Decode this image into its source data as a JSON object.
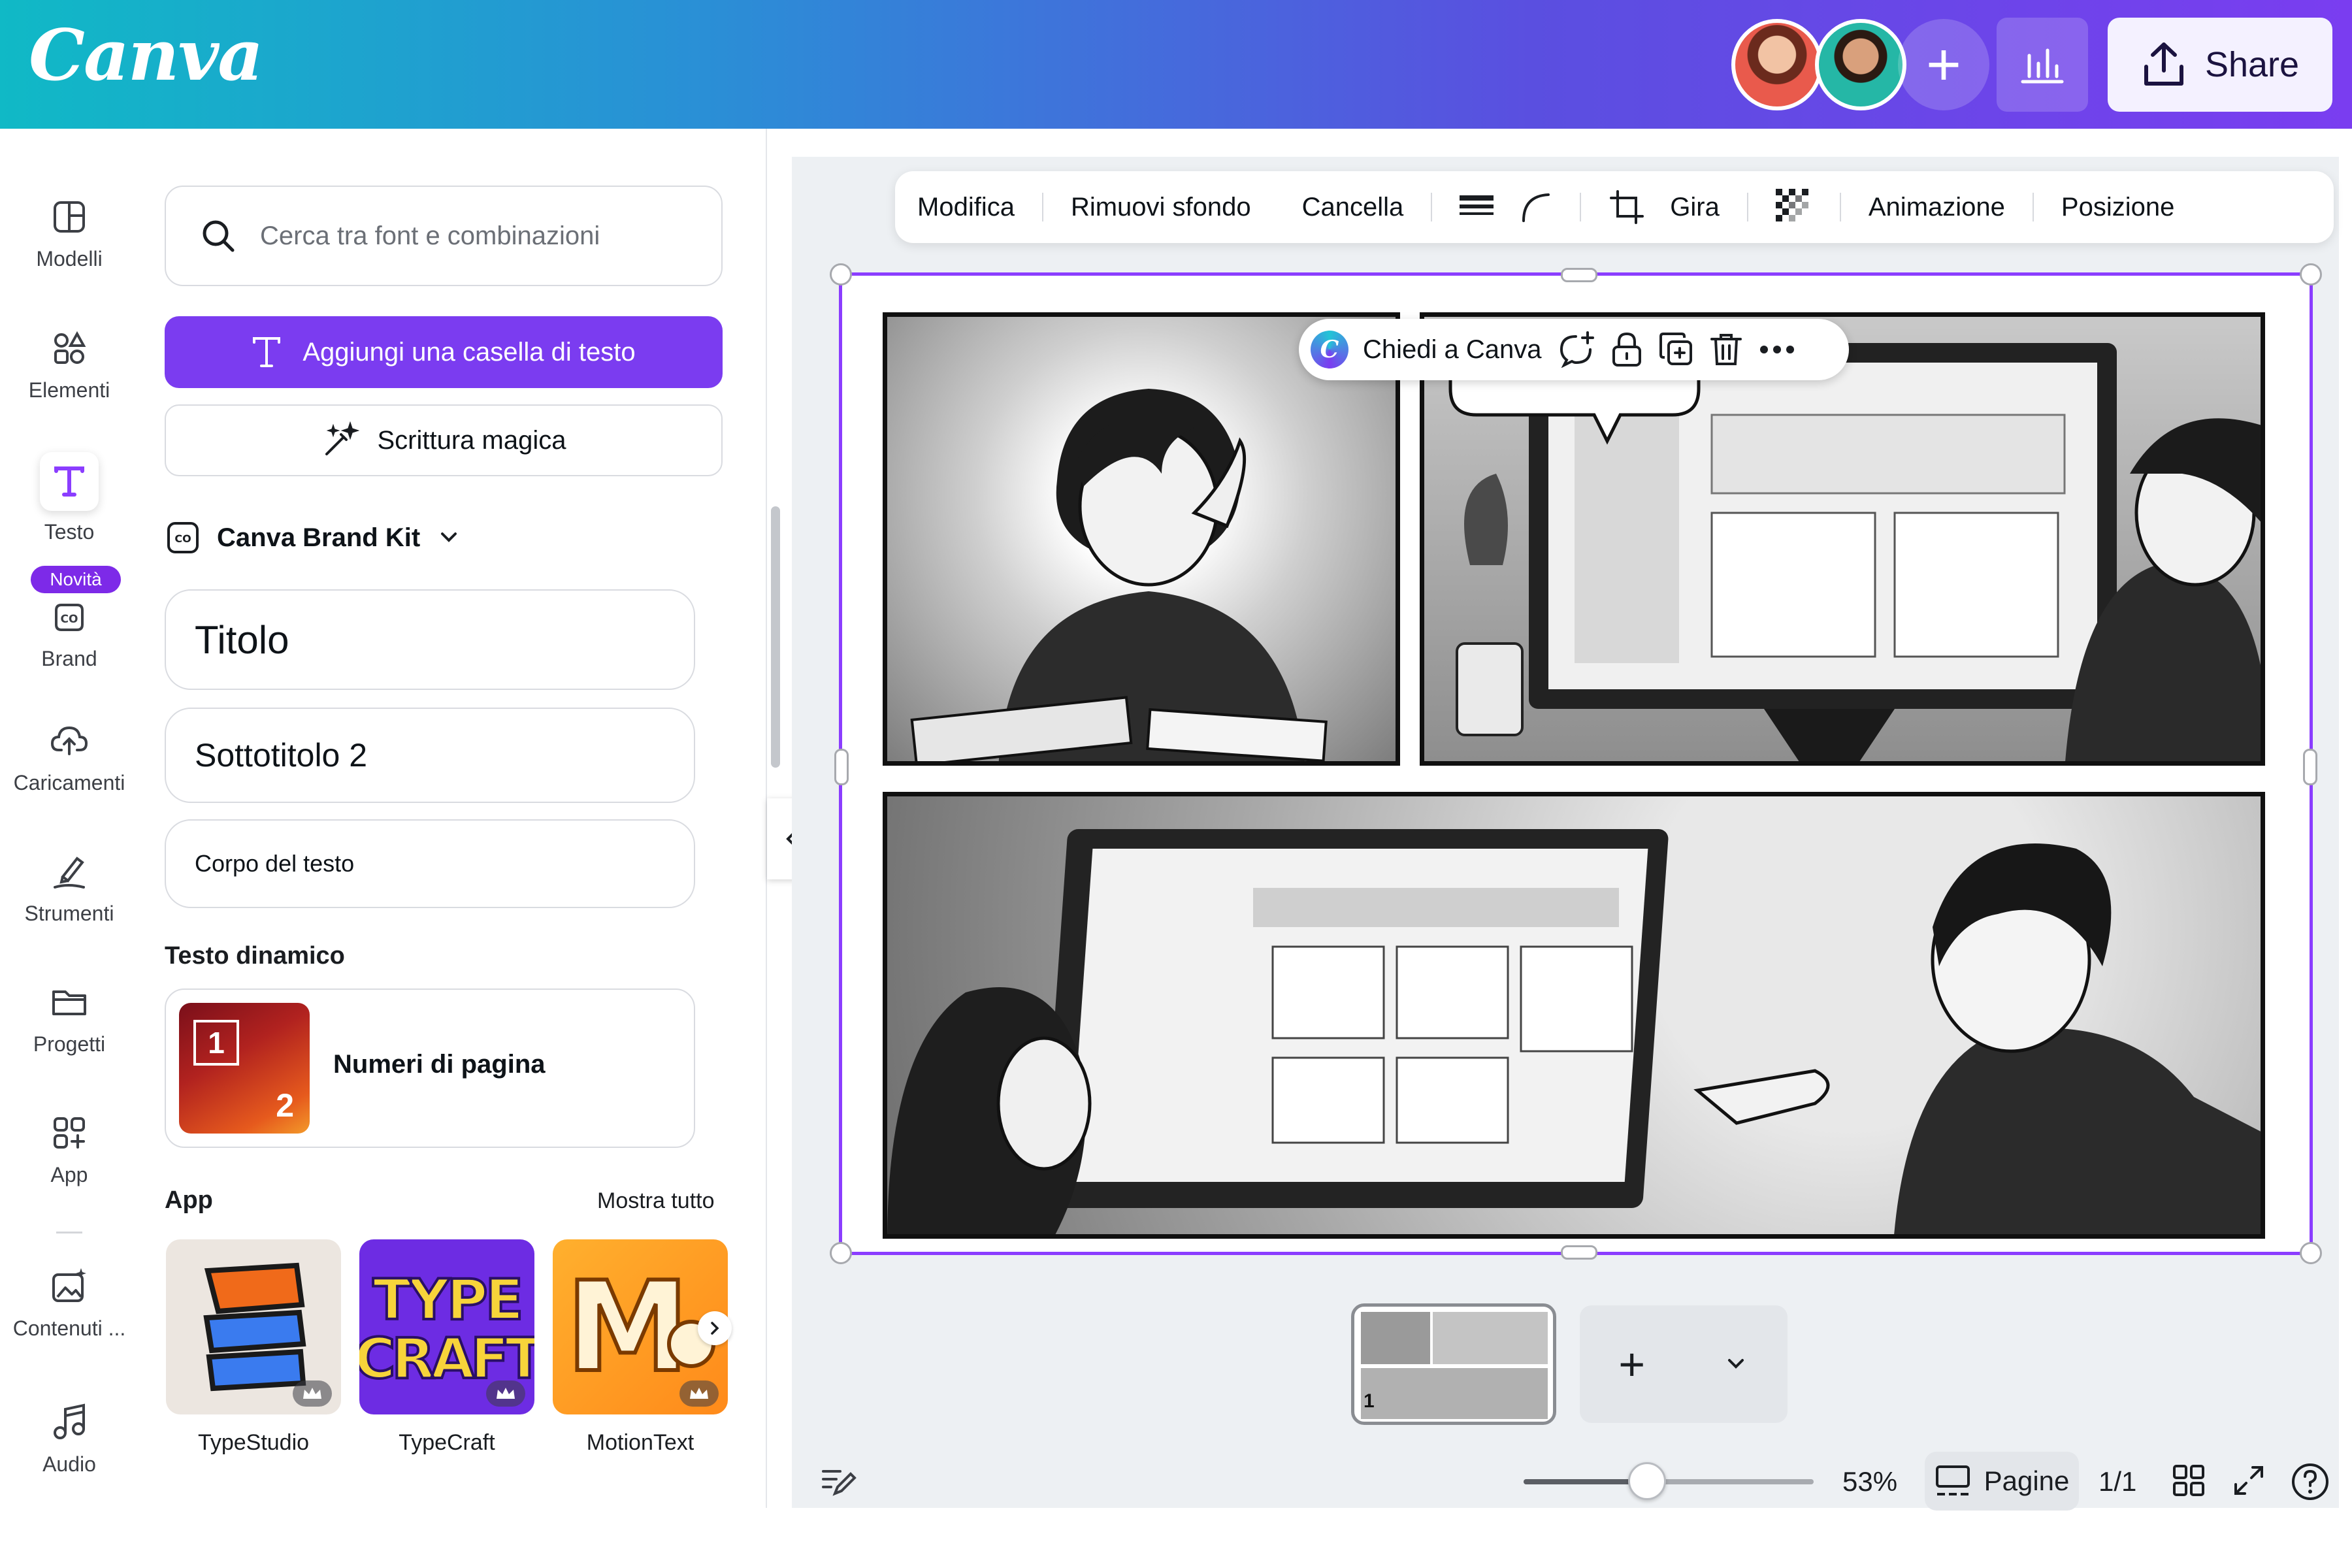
{
  "header": {
    "logo": "Canva",
    "share_label": "Share",
    "add_collaborator": "+"
  },
  "rail": {
    "items": [
      {
        "label": "Modelli",
        "icon": "template-icon"
      },
      {
        "label": "Elementi",
        "icon": "elements-icon"
      },
      {
        "label": "Testo",
        "icon": "text-icon"
      },
      {
        "label": "Brand",
        "icon": "brand-icon"
      },
      {
        "label": "Caricamenti",
        "icon": "upload-cloud-icon"
      },
      {
        "label": "Strumenti",
        "icon": "draw-tools-icon"
      },
      {
        "label": "Progetti",
        "icon": "folder-icon"
      },
      {
        "label": "App",
        "icon": "apps-icon"
      },
      {
        "label": "Contenuti ...",
        "icon": "magic-media-icon"
      },
      {
        "label": "Audio",
        "icon": "music-note-icon"
      }
    ],
    "badge": "Novità"
  },
  "panel": {
    "search_placeholder": "Cerca tra font e combinazioni",
    "add_textbox": "Aggiungi una casella di testo",
    "magic_write": "Scrittura magica",
    "brand_kit": "Canva Brand Kit",
    "styles": {
      "title": "Titolo",
      "subtitle": "Sottotitolo 2",
      "body": "Corpo del testo"
    },
    "dynamic_text_heading": "Testo dinamico",
    "dynamic_text_item": "Numeri di pagina",
    "dynamic_thumb_numbers": [
      "1",
      "2"
    ],
    "apps_heading": "App",
    "see_all": "Mostra tutto",
    "apps": [
      {
        "name": "TypeStudio"
      },
      {
        "name": "TypeCraft"
      },
      {
        "name": "MotionText"
      }
    ]
  },
  "toolbar": {
    "edit": "Modifica",
    "remove_bg": "Rimuovi sfondo",
    "erase": "Cancella",
    "flip": "Gira",
    "animate": "Animazione",
    "position": "Posizione"
  },
  "selection": {
    "ask_canva": "Chiedi a Canva"
  },
  "pages": {
    "thumb_number": "1",
    "add_symbol": "+"
  },
  "footer": {
    "zoom": "53%",
    "zoom_fraction": 0.53,
    "pages_label": "Pagine",
    "page_count": "1/1"
  },
  "colors": {
    "accent": "#7b3cf0",
    "selection": "#8b3dff",
    "header_start": "#10b9c6",
    "header_end": "#7a3df0"
  }
}
